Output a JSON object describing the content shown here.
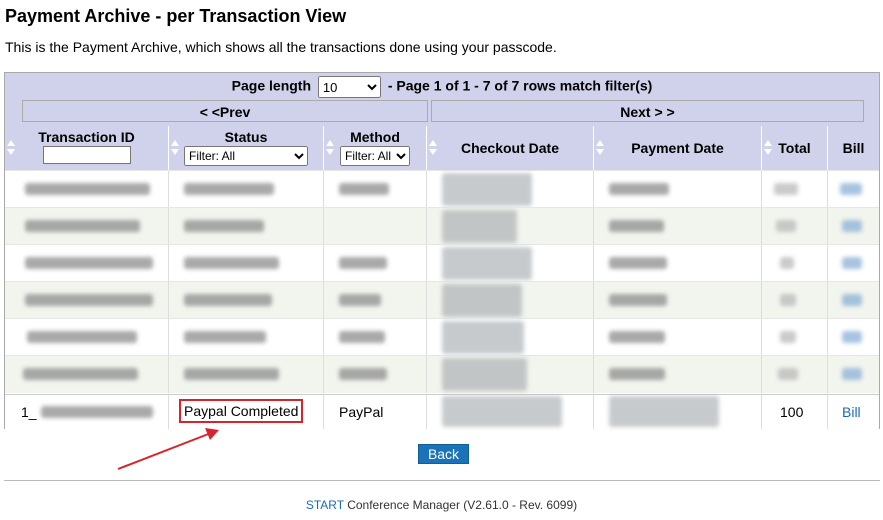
{
  "page": {
    "title": "Payment Archive - per Transaction View",
    "intro": "This is the Payment Archive, which shows all the transactions done using your passcode."
  },
  "pager": {
    "page_length_label": "Page length",
    "page_length_value": "10",
    "page_info": "- Page  1 of 1 - 7 of 7 rows match filter(s)",
    "prev_label": "< <Prev",
    "next_label": "Next > >"
  },
  "table": {
    "columns": {
      "transaction_id": "Transaction ID",
      "status": "Status",
      "method": "Method",
      "checkout_date": "Checkout Date",
      "payment_date": "Payment Date",
      "total": "Total",
      "bill": "Bill"
    },
    "status_filter": "Filter: All",
    "method_filter": "Filter: All",
    "last_row": {
      "transaction_id_visible": "1_",
      "status": "Paypal Completed",
      "method": "PayPal",
      "total": "100",
      "bill": "Bill"
    }
  },
  "actions": {
    "back_label": "Back"
  },
  "footer": {
    "product_link": "START",
    "product_rest": " Conference Manager (V2.61.0 - Rev. 6099)"
  },
  "colors": {
    "header_bg": "#cfd2ea",
    "alt_row_bg": "#f2f4ee",
    "highlight": "#d9232b",
    "link": "#1a6ab8",
    "button": "#1a73b8"
  },
  "icons": {
    "sort": "sort-arrows-icon",
    "annotation": "red-arrow-annotation"
  }
}
